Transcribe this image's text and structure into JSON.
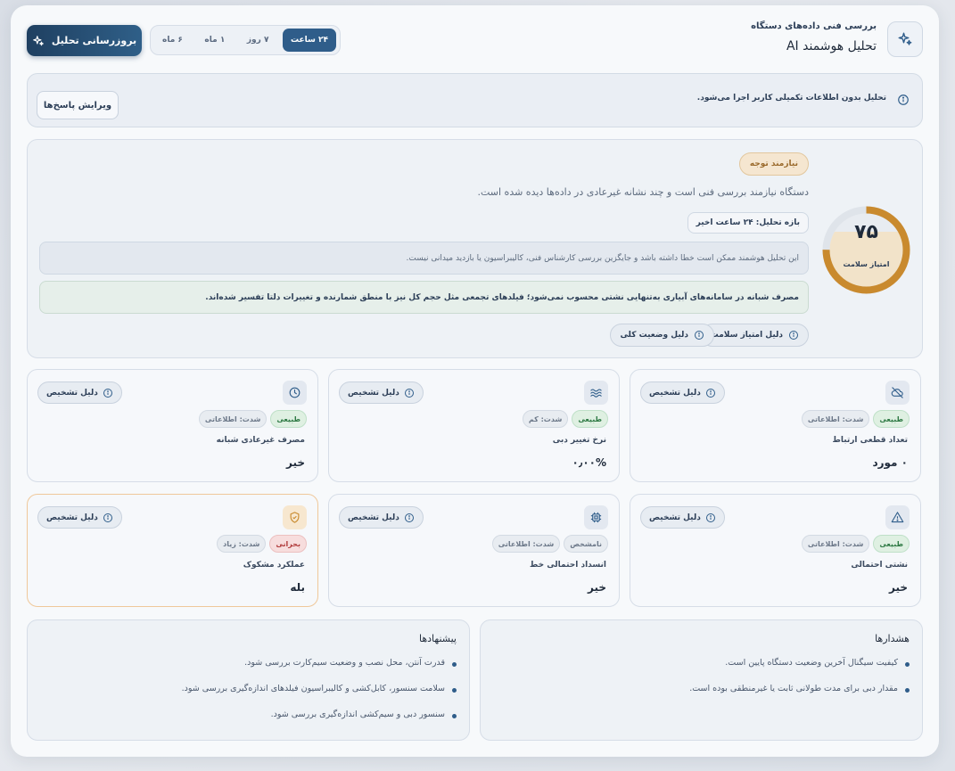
{
  "header": {
    "subtitle": "بررسی فنی داده‌های دستگاه",
    "title": "تحلیل هوشمند AI",
    "icon": "sparkles-icon",
    "ranges": [
      {
        "label": "۲۴ ساعت",
        "active": true
      },
      {
        "label": "۷ روز",
        "active": false
      },
      {
        "label": "۱ ماه",
        "active": false
      },
      {
        "label": "۶ ماه",
        "active": false
      }
    ],
    "refresh_label": "بروزرسانی تحلیل"
  },
  "notice": {
    "text": "تحلیل بدون اطلاعات تکمیلی کاربر اجرا می‌شود.",
    "edit_label": "ویرایش پاسخ‌ها"
  },
  "overview": {
    "status_badge": "نیازمند توجه",
    "description": "دستگاه نیازمند بررسی فنی است و چند نشانه غیرعادی در داده‌ها دیده شده است.",
    "period": "بازه تحلیل: ۲۴ ساعت اخیر",
    "disclaimer": "این تحلیل هوشمند ممکن است خطا داشته باشد و جایگزین بررسی کارشناس فنی، کالیبراسیون یا بازدید میدانی نیست.",
    "note": "مصرف شبانه در سامانه‌های آبیاری به‌تنهایی نشتی محسوب نمی‌شود؛ فیلدهای تجمعی مثل حجم کل نیز با منطق شمارنده و تغییرات دلتا تفسیر شده‌اند.",
    "score_reason_label": "دلیل امتیاز سلامت",
    "overall_reason_label": "دلیل وضعیت کلی",
    "score": "۷۵",
    "score_fraction": 0.75,
    "score_label": "امتیاز سلامت"
  },
  "metrics": [
    {
      "icon": "disconnect-icon",
      "status": "طبیعی",
      "severity": "شدت: اطلاعاتی",
      "label": "تعداد قطعی ارتباط",
      "value": "۰ مورد",
      "reason": "دلیل تشخیص"
    },
    {
      "icon": "waves-icon",
      "status": "طبیعی",
      "severity": "شدت: کم",
      "label": "نرخ تغییر دبی",
      "value": "۰٫۰۰%",
      "reason": "دلیل تشخیص"
    },
    {
      "icon": "clock-icon",
      "status": "طبیعی",
      "severity": "شدت: اطلاعاتی",
      "label": "مصرف غیرعادی شبانه",
      "value": "خیر",
      "reason": "دلیل تشخیص"
    },
    {
      "icon": "warning-icon",
      "status": "طبیعی",
      "severity": "شدت: اطلاعاتی",
      "label": "نشتی احتمالی",
      "value": "خیر",
      "reason": "دلیل تشخیص"
    },
    {
      "icon": "chip-icon",
      "status": "نامشخص",
      "severity": "شدت: اطلاعاتی",
      "label": "انسداد احتمالی خط",
      "value": "خیر",
      "reason": "دلیل تشخیص"
    },
    {
      "icon": "shield-icon",
      "status": "بحرانی",
      "severity": "شدت: زیاد",
      "label": "عملکرد مشکوک",
      "value": "بله",
      "reason": "دلیل تشخیص"
    }
  ],
  "alerts": {
    "title": "هشدارها",
    "items": [
      "کیفیت سیگنال آخرین وضعیت دستگاه پایین است.",
      "مقدار دبی برای مدت طولانی ثابت یا غیرمنطقی بوده است."
    ]
  },
  "suggestions": {
    "title": "پیشنهادها",
    "items": [
      "قدرت آنتن، محل نصب و وضعیت سیم‌کارت بررسی شود.",
      "سلامت سنسور، کابل‌کشی و کالیبراسیون فیلدهای اندازه‌گیری بررسی شود.",
      "سنسور دبی و سیم‌کشی اندازه‌گیری بررسی شود."
    ]
  },
  "colors": {
    "accent": "#2f5d8a",
    "score_ring": "#c98a2e",
    "score_fill": "#f2e3c9"
  }
}
